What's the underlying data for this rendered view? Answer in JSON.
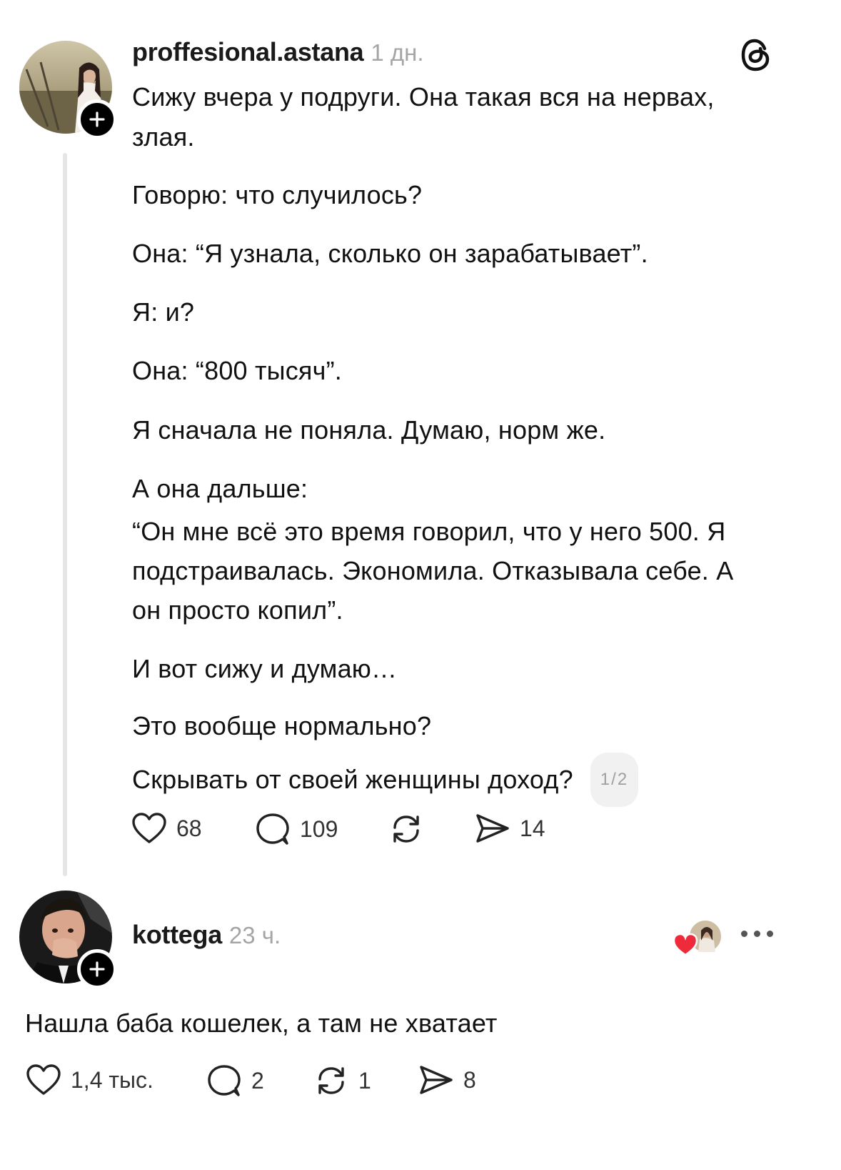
{
  "post": {
    "username": "proffesional.astana",
    "time": "1 дн.",
    "lines": [
      "Сижу вчера у подруги. Она такая вся на нервах,",
      "злая.",
      "Говорю: что случилось?",
      "Она: “Я узнала, сколько он зарабатывает”.",
      "Я: и?",
      "Она: “800 тысяч”.",
      "Я сначала не поняла. Думаю, норм же.",
      "А она дальше:",
      "“Он мне всё это время говорил, что у него 500. Я",
      "подстраивалась. Экономила. Отказывала себе. А",
      "он просто копил”.",
      "И вот сижу и думаю…",
      "Это вообще нормально?",
      "Скрывать от своей женщины доход?"
    ],
    "page_indicator": "1/2",
    "likes": "68",
    "comments": "109",
    "shares": "14"
  },
  "reply": {
    "username": "kottega",
    "time": "23 ч.",
    "text": "Нашла баба кошелек, а там не хватает",
    "likes": "1,4 тыс.",
    "comments": "2",
    "reposts": "1",
    "shares": "8"
  },
  "colors": {
    "heart_red": "#ef2a3a",
    "text": "#111111",
    "muted": "#a5a5a5"
  }
}
